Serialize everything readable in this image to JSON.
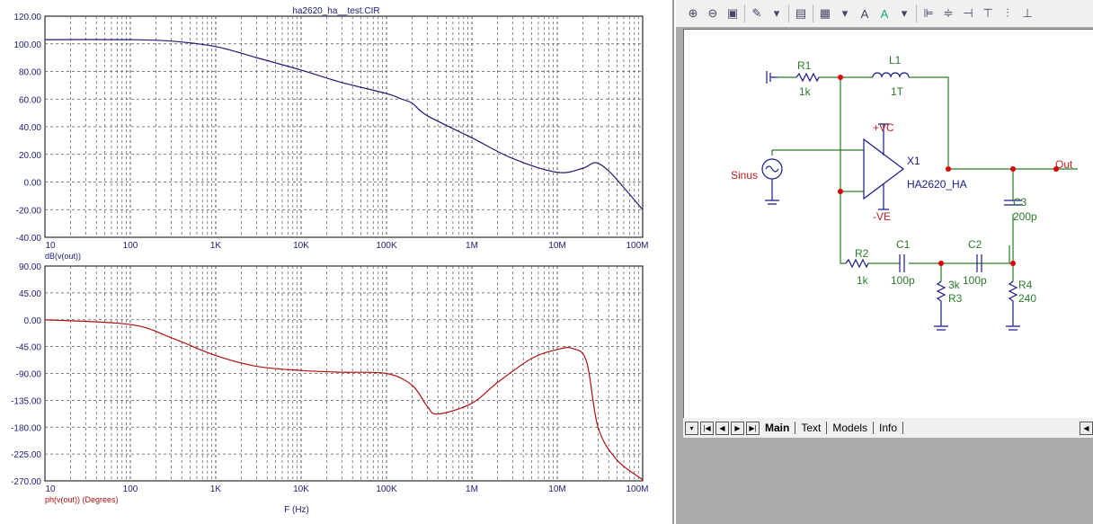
{
  "plot": {
    "title": "ha2620_ha__test.CIR",
    "xlabel": "F (Hz)",
    "xticks": [
      "10",
      "100",
      "1K",
      "10K",
      "100K",
      "1M",
      "10M",
      "100M"
    ],
    "top": {
      "ylabel": "dB(v(out))",
      "yticks": [
        "120.00",
        "100.00",
        "80.00",
        "60.00",
        "40.00",
        "20.00",
        "0.00",
        "-20.00",
        "-40.00"
      ],
      "color": "#1c1c78"
    },
    "bottom": {
      "ylabel": "ph(v(out)) (Degrees)",
      "yticks": [
        "90.00",
        "45.00",
        "0.00",
        "-45.00",
        "-90.00",
        "-135.00",
        "-180.00",
        "-225.00",
        "-270.00"
      ],
      "color": "#b01010"
    }
  },
  "chart_data": [
    {
      "type": "line",
      "title": "ha2620_ha__test.CIR",
      "xlabel": "F (Hz)",
      "ylabel": "dB(v(out))",
      "xscale": "log",
      "xlim": [
        10,
        100000000
      ],
      "ylim": [
        -40,
        120
      ],
      "grid": true,
      "series": [
        {
          "name": "dB(v(out))",
          "x": [
            10,
            100,
            300,
            1000,
            3000,
            10000,
            30000,
            100000,
            150000,
            200000,
            300000,
            1000000,
            3000000,
            10000000,
            20000000,
            28000000,
            40000000,
            60000000,
            100000000
          ],
          "y": [
            103,
            103,
            102,
            98,
            90,
            81,
            72,
            64,
            60,
            57,
            48,
            32,
            17,
            7,
            10,
            14,
            8,
            -4,
            -20
          ]
        }
      ]
    },
    {
      "type": "line",
      "xlabel": "F (Hz)",
      "ylabel": "ph(v(out)) (Degrees)",
      "xscale": "log",
      "xlim": [
        10,
        100000000
      ],
      "ylim": [
        -270,
        90
      ],
      "grid": true,
      "series": [
        {
          "name": "ph(v(out))",
          "x": [
            10,
            100,
            300,
            1000,
            3000,
            10000,
            30000,
            100000,
            200000,
            300000,
            400000,
            1000000,
            2000000,
            5000000,
            10000000,
            15000000,
            22000000,
            30000000,
            50000000,
            100000000
          ],
          "y": [
            0,
            -8,
            -30,
            -60,
            -78,
            -85,
            -88,
            -90,
            -110,
            -145,
            -158,
            -140,
            -105,
            -65,
            -50,
            -48,
            -70,
            -180,
            -235,
            -268
          ]
        }
      ]
    }
  ],
  "toolbar": {
    "icons": [
      "zoom-in-icon",
      "zoom-out-icon",
      "zoom-100-icon",
      "wire-icon",
      "snapshot-icon",
      "grid-icon",
      "font-icon",
      "text-color-icon",
      "align-left-icon",
      "align-center-icon",
      "align-right-icon",
      "align-top-icon",
      "align-middle-icon",
      "align-bottom-icon"
    ]
  },
  "schematic": {
    "labels": {
      "r1": "R1",
      "r1v": "1k",
      "l1": "L1",
      "l1v": "1T",
      "vc": "+VC",
      "ve": "-VE",
      "x1": "X1",
      "x1v": "HA2620_HA",
      "sinus": "Sinus",
      "out": "Out",
      "c3": "C3",
      "c3v": "200p",
      "r2": "R2",
      "r2v": "1k",
      "c1": "C1",
      "c1v": "100p",
      "c2": "C2",
      "c2v": "100p",
      "r3": "R3",
      "r3v": "3k",
      "r4": "R4",
      "r4v": "240"
    }
  },
  "tabs": [
    "Main",
    "Text",
    "Models",
    "Info"
  ]
}
